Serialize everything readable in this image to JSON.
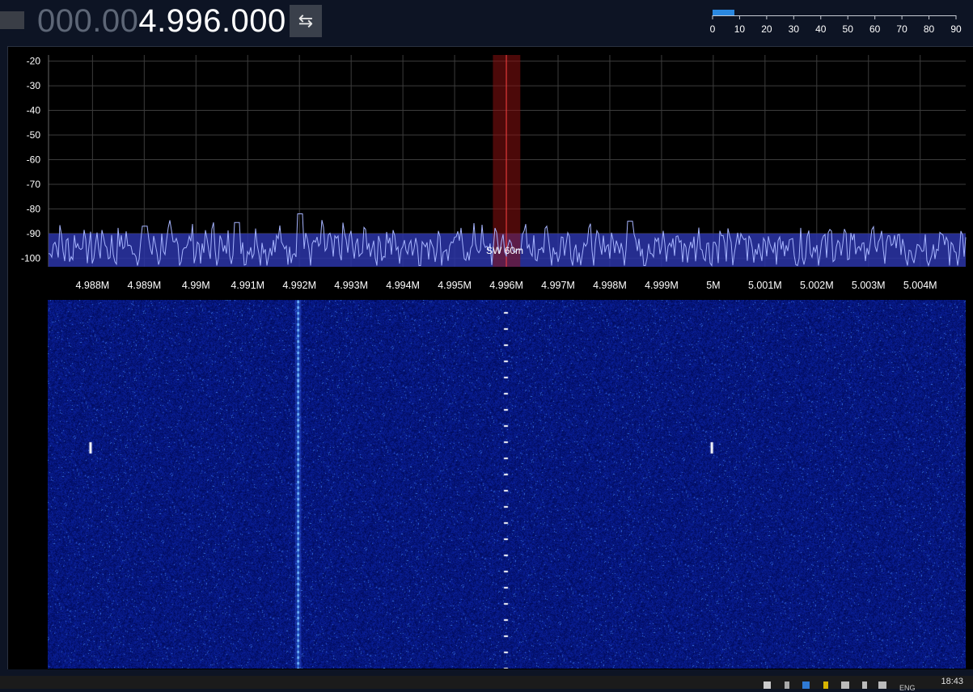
{
  "frequency_display": {
    "dim_prefix": "000.00",
    "value": "4.996.000"
  },
  "swap_button": {
    "icon": "swap-arrows-icon",
    "glyph": "⇆"
  },
  "smeter": {
    "level": 8,
    "ticks": [
      "0",
      "10",
      "20",
      "30",
      "40",
      "50",
      "60",
      "70",
      "80",
      "90"
    ],
    "color": "#2a88e0"
  },
  "spectrum": {
    "y_ticks": [
      -20,
      -30,
      -40,
      -50,
      -60,
      -70,
      -80,
      -90,
      -100
    ],
    "y_range": [
      -17.5,
      -103.5
    ],
    "x_range": [
      4.98715,
      5.00488
    ],
    "x_ticks": [
      {
        "v": 4.988,
        "label": "4.988M"
      },
      {
        "v": 4.989,
        "label": "4.989M"
      },
      {
        "v": 4.99,
        "label": "4.99M"
      },
      {
        "v": 4.991,
        "label": "4.991M"
      },
      {
        "v": 4.992,
        "label": "4.992M"
      },
      {
        "v": 4.993,
        "label": "4.993M"
      },
      {
        "v": 4.994,
        "label": "4.994M"
      },
      {
        "v": 4.995,
        "label": "4.995M"
      },
      {
        "v": 4.996,
        "label": "4.996M"
      },
      {
        "v": 4.997,
        "label": "4.997M"
      },
      {
        "v": 4.998,
        "label": "4.998M"
      },
      {
        "v": 4.999,
        "label": "4.999M"
      },
      {
        "v": 5.0,
        "label": "5M"
      },
      {
        "v": 5.001,
        "label": "5.001M"
      },
      {
        "v": 5.002,
        "label": "5.002M"
      },
      {
        "v": 5.003,
        "label": "5.003M"
      },
      {
        "v": 5.004,
        "label": "5.004M"
      }
    ],
    "tuned_freq": 4.996,
    "passband": [
      4.99574,
      4.99627
    ],
    "band_label": "SW 60m",
    "noise_floor": -95,
    "peaks": [
      {
        "v": 4.992,
        "db": -82
      },
      {
        "v": 4.9984,
        "db": -85
      },
      {
        "v": 4.9908,
        "db": -85.5
      },
      {
        "v": 4.989,
        "db": -87
      }
    ],
    "trace_color": "#a6b4ff",
    "fill_color": "#2b35a8"
  },
  "waterfall": {
    "signals": [
      {
        "v": 4.992,
        "kind": "carrier"
      },
      {
        "v": 4.996,
        "kind": "pulses"
      },
      {
        "v": 4.98797,
        "kind": "burst"
      },
      {
        "v": 4.99998,
        "kind": "burst"
      }
    ],
    "color": "#0a1896"
  },
  "taskbar": {
    "clock": "18:43",
    "lang": "ENG"
  }
}
